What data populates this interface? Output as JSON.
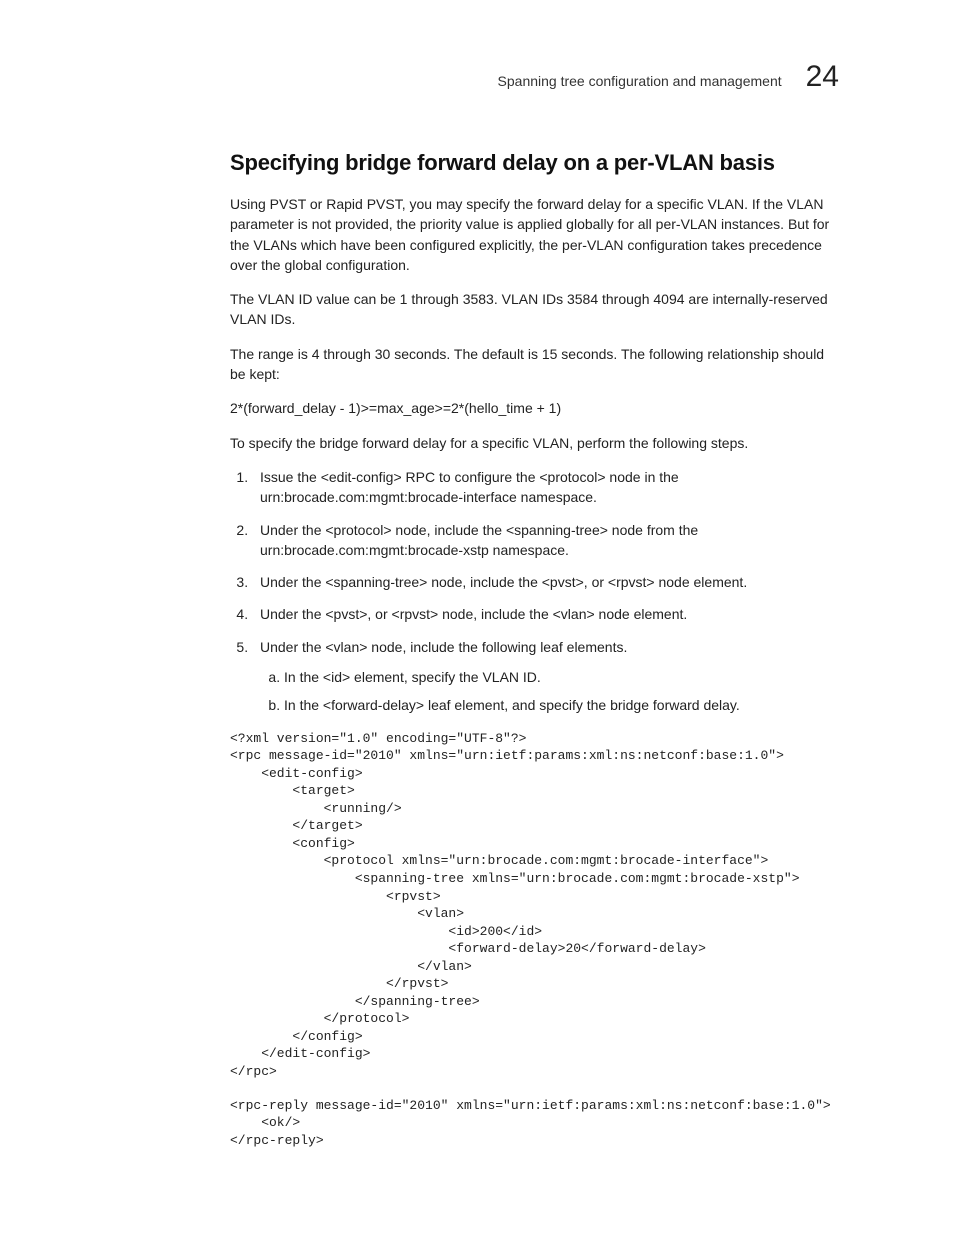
{
  "header": {
    "running_title": "Spanning tree configuration and management",
    "chapter_number": "24"
  },
  "section": {
    "title": "Specifying bridge forward delay on a per-VLAN basis",
    "paragraphs": {
      "intro": "Using PVST or Rapid PVST, you may specify the forward delay for a specific VLAN. If the VLAN parameter is not provided, the priority value is applied globally for all per-VLAN instances. But for the VLANs which have been configured explicitly, the per-VLAN configuration takes precedence over the global configuration.",
      "vlan_id_range": "The VLAN ID value can be 1 through 3583. VLAN IDs 3584 through 4094 are internally-reserved VLAN IDs.",
      "range_default": "The range is 4 through 30 seconds. The default is 15 seconds. The following relationship should be kept:",
      "formula": "2*(forward_delay - 1)>=max_age>=2*(hello_time + 1)",
      "lead_in": "To specify the bridge forward delay for a specific VLAN, perform the following steps."
    },
    "steps": [
      "Issue the <edit-config> RPC to configure the <protocol> node in the urn:brocade.com:mgmt:brocade-interface namespace.",
      "Under the <protocol> node, include the <spanning-tree> node from the urn:brocade.com:mgmt:brocade-xstp namespace.",
      "Under the <spanning-tree> node, include the <pvst>, or <rpvst> node element.",
      "Under the <pvst>, or <rpvst> node, include the <vlan> node element.",
      "Under the <vlan> node, include the following leaf elements."
    ],
    "substeps": [
      "In the <id> element, specify the VLAN ID.",
      "In the <forward-delay> leaf element, and specify the bridge forward delay."
    ],
    "code_request": "<?xml version=\"1.0\" encoding=\"UTF-8\"?>\n<rpc message-id=\"2010\" xmlns=\"urn:ietf:params:xml:ns:netconf:base:1.0\">\n    <edit-config>\n        <target>\n            <running/>\n        </target>\n        <config>\n            <protocol xmlns=\"urn:brocade.com:mgmt:brocade-interface\">\n                <spanning-tree xmlns=\"urn:brocade.com:mgmt:brocade-xstp\">\n                    <rpvst>\n                        <vlan>\n                            <id>200</id>\n                            <forward-delay>20</forward-delay>\n                        </vlan>\n                    </rpvst>\n                </spanning-tree>\n            </protocol>\n        </config>\n    </edit-config>\n</rpc>",
    "code_reply": "<rpc-reply message-id=\"2010\" xmlns=\"urn:ietf:params:xml:ns:netconf:base:1.0\">\n    <ok/>\n</rpc-reply>"
  }
}
